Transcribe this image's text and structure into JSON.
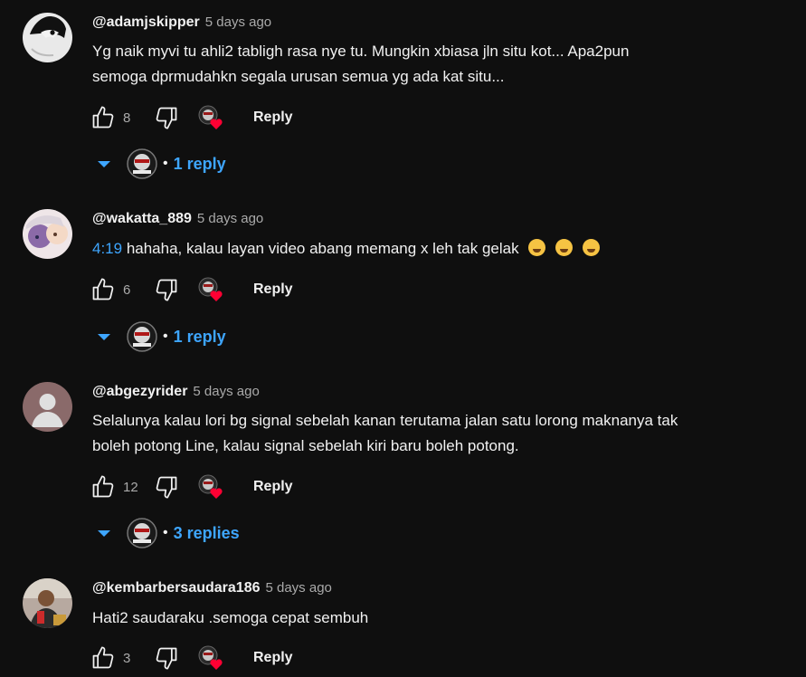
{
  "comments": [
    {
      "author": "@adamjskipper",
      "time": "5 days ago",
      "text_lines": [
        "Yg naik myvi tu ahli2 tabligh rasa nye tu. Mungkin xbiasa jln situ kot... Apa2pun",
        "semoga dprmudahkn segala urusan semua yg ada kat situ..."
      ],
      "likes": "8",
      "reply_label": "Reply",
      "replies_label": "1 reply"
    },
    {
      "author": "@wakatta_889",
      "time": "5 days ago",
      "timestamp": "4:19",
      "text": " hahaha, kalau layan video abang memang x leh tak gelak",
      "likes": "6",
      "reply_label": "Reply",
      "replies_label": "1 reply"
    },
    {
      "author": "@abgezyrider",
      "time": "5 days ago",
      "text_lines": [
        "Selalunya kalau lori bg signal sebelah kanan terutama jalan satu lorong maknanya tak",
        "boleh potong Line, kalau signal sebelah kiri baru boleh potong."
      ],
      "likes": "12",
      "reply_label": "Reply",
      "replies_label": "3 replies"
    },
    {
      "author": "@kembarbersaudara186",
      "time": "5 days ago",
      "text": "Hati2 saudaraku .semoga cepat sembuh",
      "likes": "3",
      "reply_label": "Reply"
    }
  ],
  "separator": "•",
  "icons": {
    "like": "thumb-up-icon",
    "dislike": "thumb-down-icon",
    "creator_heart": "creator-heart-icon",
    "expand": "caret-down-icon"
  },
  "colors": {
    "background": "#0f0f0f",
    "link": "#3ea6ff",
    "secondary_text": "#aaaaaa",
    "heart": "#ff0033"
  }
}
